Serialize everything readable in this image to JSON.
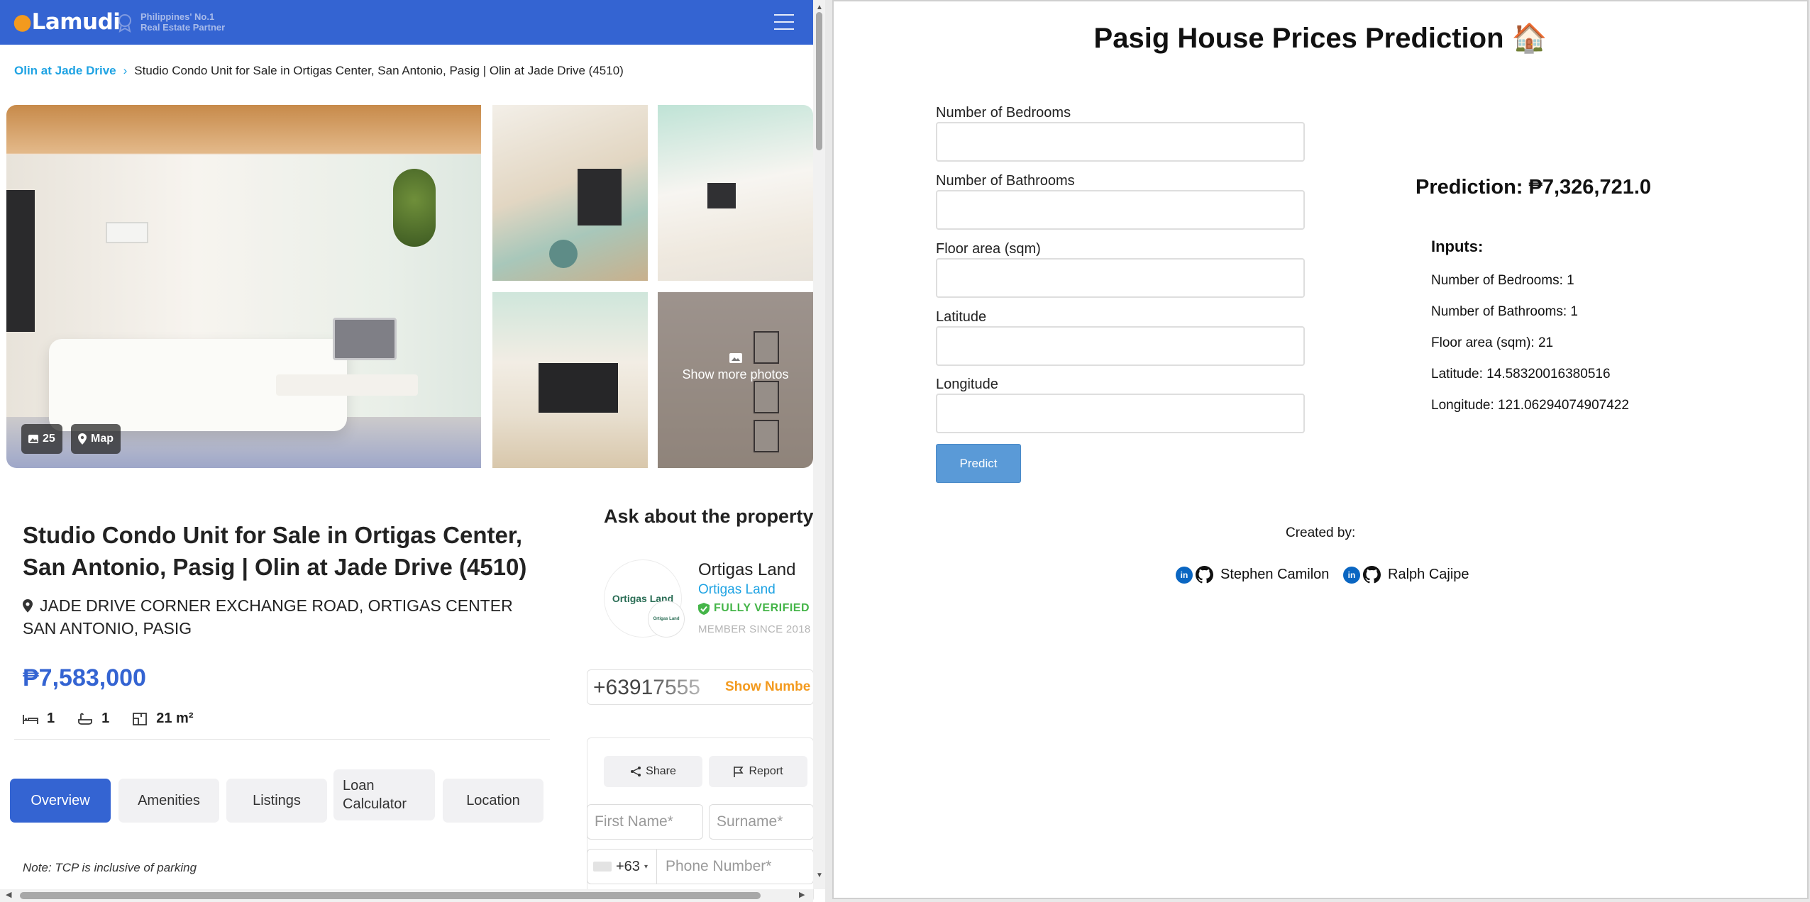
{
  "listing_site": {
    "logo_text": "Lamudi",
    "partner_line1": "Philippines' No.1",
    "partner_line2": "Real Estate Partner",
    "breadcrumb": {
      "parent": "Olin at Jade Drive",
      "current": "Studio Condo Unit for Sale in Ortigas Center, San Antonio, Pasig | Olin at Jade Drive (4510)"
    },
    "gallery": {
      "photo_count": "25",
      "map_label": "Map",
      "more_photos_label": "Show more photos"
    },
    "title": "Studio Condo Unit for Sale in Ortigas Center, San Antonio, Pasig | Olin at Jade Drive (4510)",
    "address": "JADE DRIVE CORNER EXCHANGE ROAD, ORTIGAS CENTER SAN ANTONIO, PASIG",
    "price": "₱7,583,000",
    "specs": {
      "bedrooms": "1",
      "bathrooms": "1",
      "floor_area": "21 m²"
    },
    "tabs": [
      "Overview",
      "Amenities",
      "Listings",
      "Loan Calculator",
      "Location"
    ],
    "active_tab": "Overview",
    "note": "Note: TCP is inclusive of parking",
    "ask": {
      "heading": "Ask about the property",
      "agent_logo_text": "Ortigas Land",
      "agent_name": "Ortigas Land",
      "agent_subname": "Ortigas Land",
      "verified": "FULLY VERIFIED",
      "member_since": "MEMBER SINCE 2018",
      "phone_preview": "+63917555",
      "show_number": "Show Numbe",
      "share": "Share",
      "report": "Report",
      "first_name_placeholder": "First Name*",
      "surname_placeholder": "Surname*",
      "country_code": "+63",
      "phone_placeholder": "Phone Number*"
    },
    "colors": {
      "brand_blue": "#3464d2",
      "brand_orange": "#f39a1e",
      "link_blue": "#1fa3e3",
      "verified_green": "#45b549"
    }
  },
  "predictor_app": {
    "title": "Pasig House Prices Prediction 🏠",
    "fields": [
      {
        "label": "Number of Bedrooms",
        "value": ""
      },
      {
        "label": "Number of Bathrooms",
        "value": ""
      },
      {
        "label": "Floor area (sqm)",
        "value": ""
      },
      {
        "label": "Latitude",
        "value": ""
      },
      {
        "label": "Longitude",
        "value": ""
      }
    ],
    "predict_button": "Predict",
    "prediction": "Prediction: ₱7,326,721.0",
    "inputs_heading": "Inputs:",
    "inputs": [
      "Number of Bedrooms: 1",
      "Number of Bathrooms: 1",
      "Floor area (sqm): 21",
      "Latitude: 14.58320016380516",
      "Longitude: 121.06294074907422"
    ],
    "created_by": "Created by:",
    "authors": [
      "Stephen Camilon",
      "Ralph Cajipe"
    ],
    "colors": {
      "button": "#5a9ad7",
      "linkedin": "#0a66c2"
    }
  }
}
